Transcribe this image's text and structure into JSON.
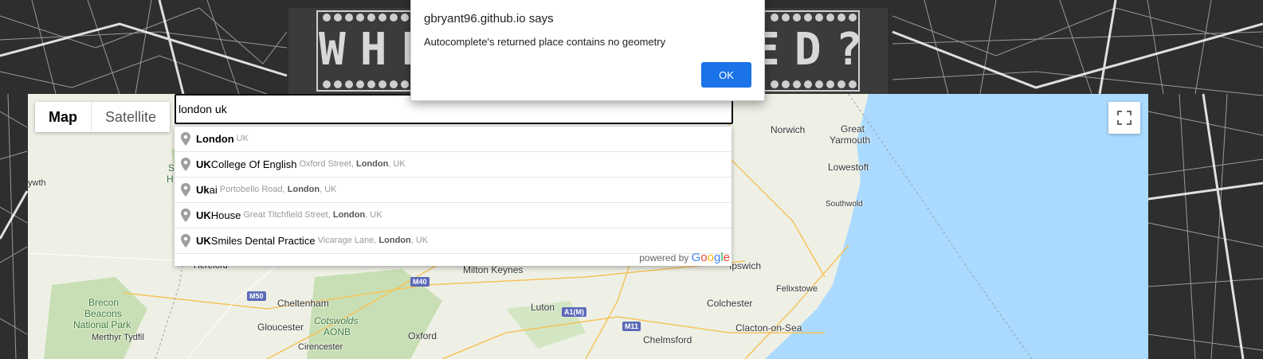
{
  "page": {
    "banner_title": "WHERE HAVE I BEEN?",
    "banner_visible_left": "WHE",
    "banner_visible_right": "ED?"
  },
  "map": {
    "type_controls": [
      {
        "label": "Map",
        "active": true
      },
      {
        "label": "Satellite",
        "active": false
      }
    ],
    "fullscreen_icon": "fullscreen-icon",
    "places": {
      "norwich": "Norwich",
      "great_yarmouth_1": "Great",
      "great_yarmouth_2": "Yarmouth",
      "lowestoft": "Lowestoft",
      "southwold": "Southwold",
      "ipswich": "Ipswich",
      "felixstowe": "Felixstowe",
      "colchester": "Colchester",
      "clacton": "Clacton-on-Sea",
      "chelmsford": "Chelmsford",
      "milton_keynes": "Milton Keynes",
      "luton": "Luton",
      "oxford": "Oxford",
      "cheltenham": "Cheltenham",
      "gloucester": "Gloucester",
      "cirencester": "Cirencester",
      "hereford": "Hereford",
      "merthyr": "Merthyr Tydfil",
      "brecon_1": "Brecon",
      "brecon_2": "Beacons",
      "brecon_3": "National Park",
      "cotswolds_1": "Cotswolds",
      "cotswolds_2": "AONB",
      "frag_ywth": "ywth",
      "frag_s": "S",
      "frag_h": "H"
    },
    "roads": {
      "m40": "M40",
      "m50": "M50",
      "a1m": "A1(M)",
      "m11": "M11"
    }
  },
  "search": {
    "value": "london uk"
  },
  "autocomplete": {
    "items": [
      {
        "match": "London",
        "rest": "",
        "secondary_pre": "",
        "secondary_match": "",
        "secondary_post": "UK"
      },
      {
        "match": "UK",
        "rest": " College Of English",
        "secondary_pre": "Oxford Street, ",
        "secondary_match": "London",
        "secondary_post": ", UK"
      },
      {
        "match": "Uk",
        "rest": "ai",
        "secondary_pre": "Portobello Road, ",
        "secondary_match": "London",
        "secondary_post": ", UK"
      },
      {
        "match": "UK",
        "rest": " House",
        "secondary_pre": "Great Titchfield Street, ",
        "secondary_match": "London",
        "secondary_post": ", UK"
      },
      {
        "match": "UK",
        "rest": " Smiles Dental Practice",
        "secondary_pre": "Vicarage Lane, ",
        "secondary_match": "London",
        "secondary_post": ", UK"
      }
    ],
    "footer_prefix": "powered by",
    "footer_brand": "Google"
  },
  "alert": {
    "title": "gbryant96.github.io says",
    "message": "Autocomplete's returned place contains no geometry",
    "ok_label": "OK"
  },
  "colors": {
    "sea": "#aadaff",
    "land": "#eef0e6",
    "park": "#c8dfb5",
    "accent": "#1a73e8"
  }
}
